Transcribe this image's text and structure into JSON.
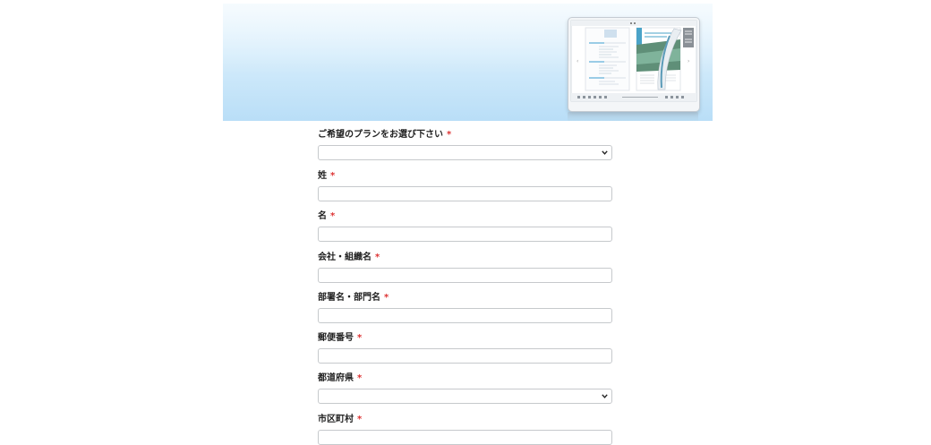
{
  "form": {
    "required_mark": "*",
    "fields": [
      {
        "label": "ご希望のプランをお選び下さい",
        "type": "select",
        "value": ""
      },
      {
        "label": "姓",
        "type": "text",
        "value": ""
      },
      {
        "label": "名",
        "type": "text",
        "value": ""
      },
      {
        "label": "会社・組織名",
        "type": "text",
        "value": ""
      },
      {
        "label": "部署名・部門名",
        "type": "text",
        "value": ""
      },
      {
        "label": "郵便番号",
        "type": "text",
        "value": ""
      },
      {
        "label": "都道府県",
        "type": "select",
        "value": ""
      },
      {
        "label": "市区町村",
        "type": "text",
        "value": ""
      }
    ]
  },
  "icons": {
    "select_chevron": "chevron-down-icon"
  },
  "colors": {
    "required": "#dd3333",
    "banner_top": "#eaf6fd",
    "banner_bottom": "#b9def7"
  }
}
